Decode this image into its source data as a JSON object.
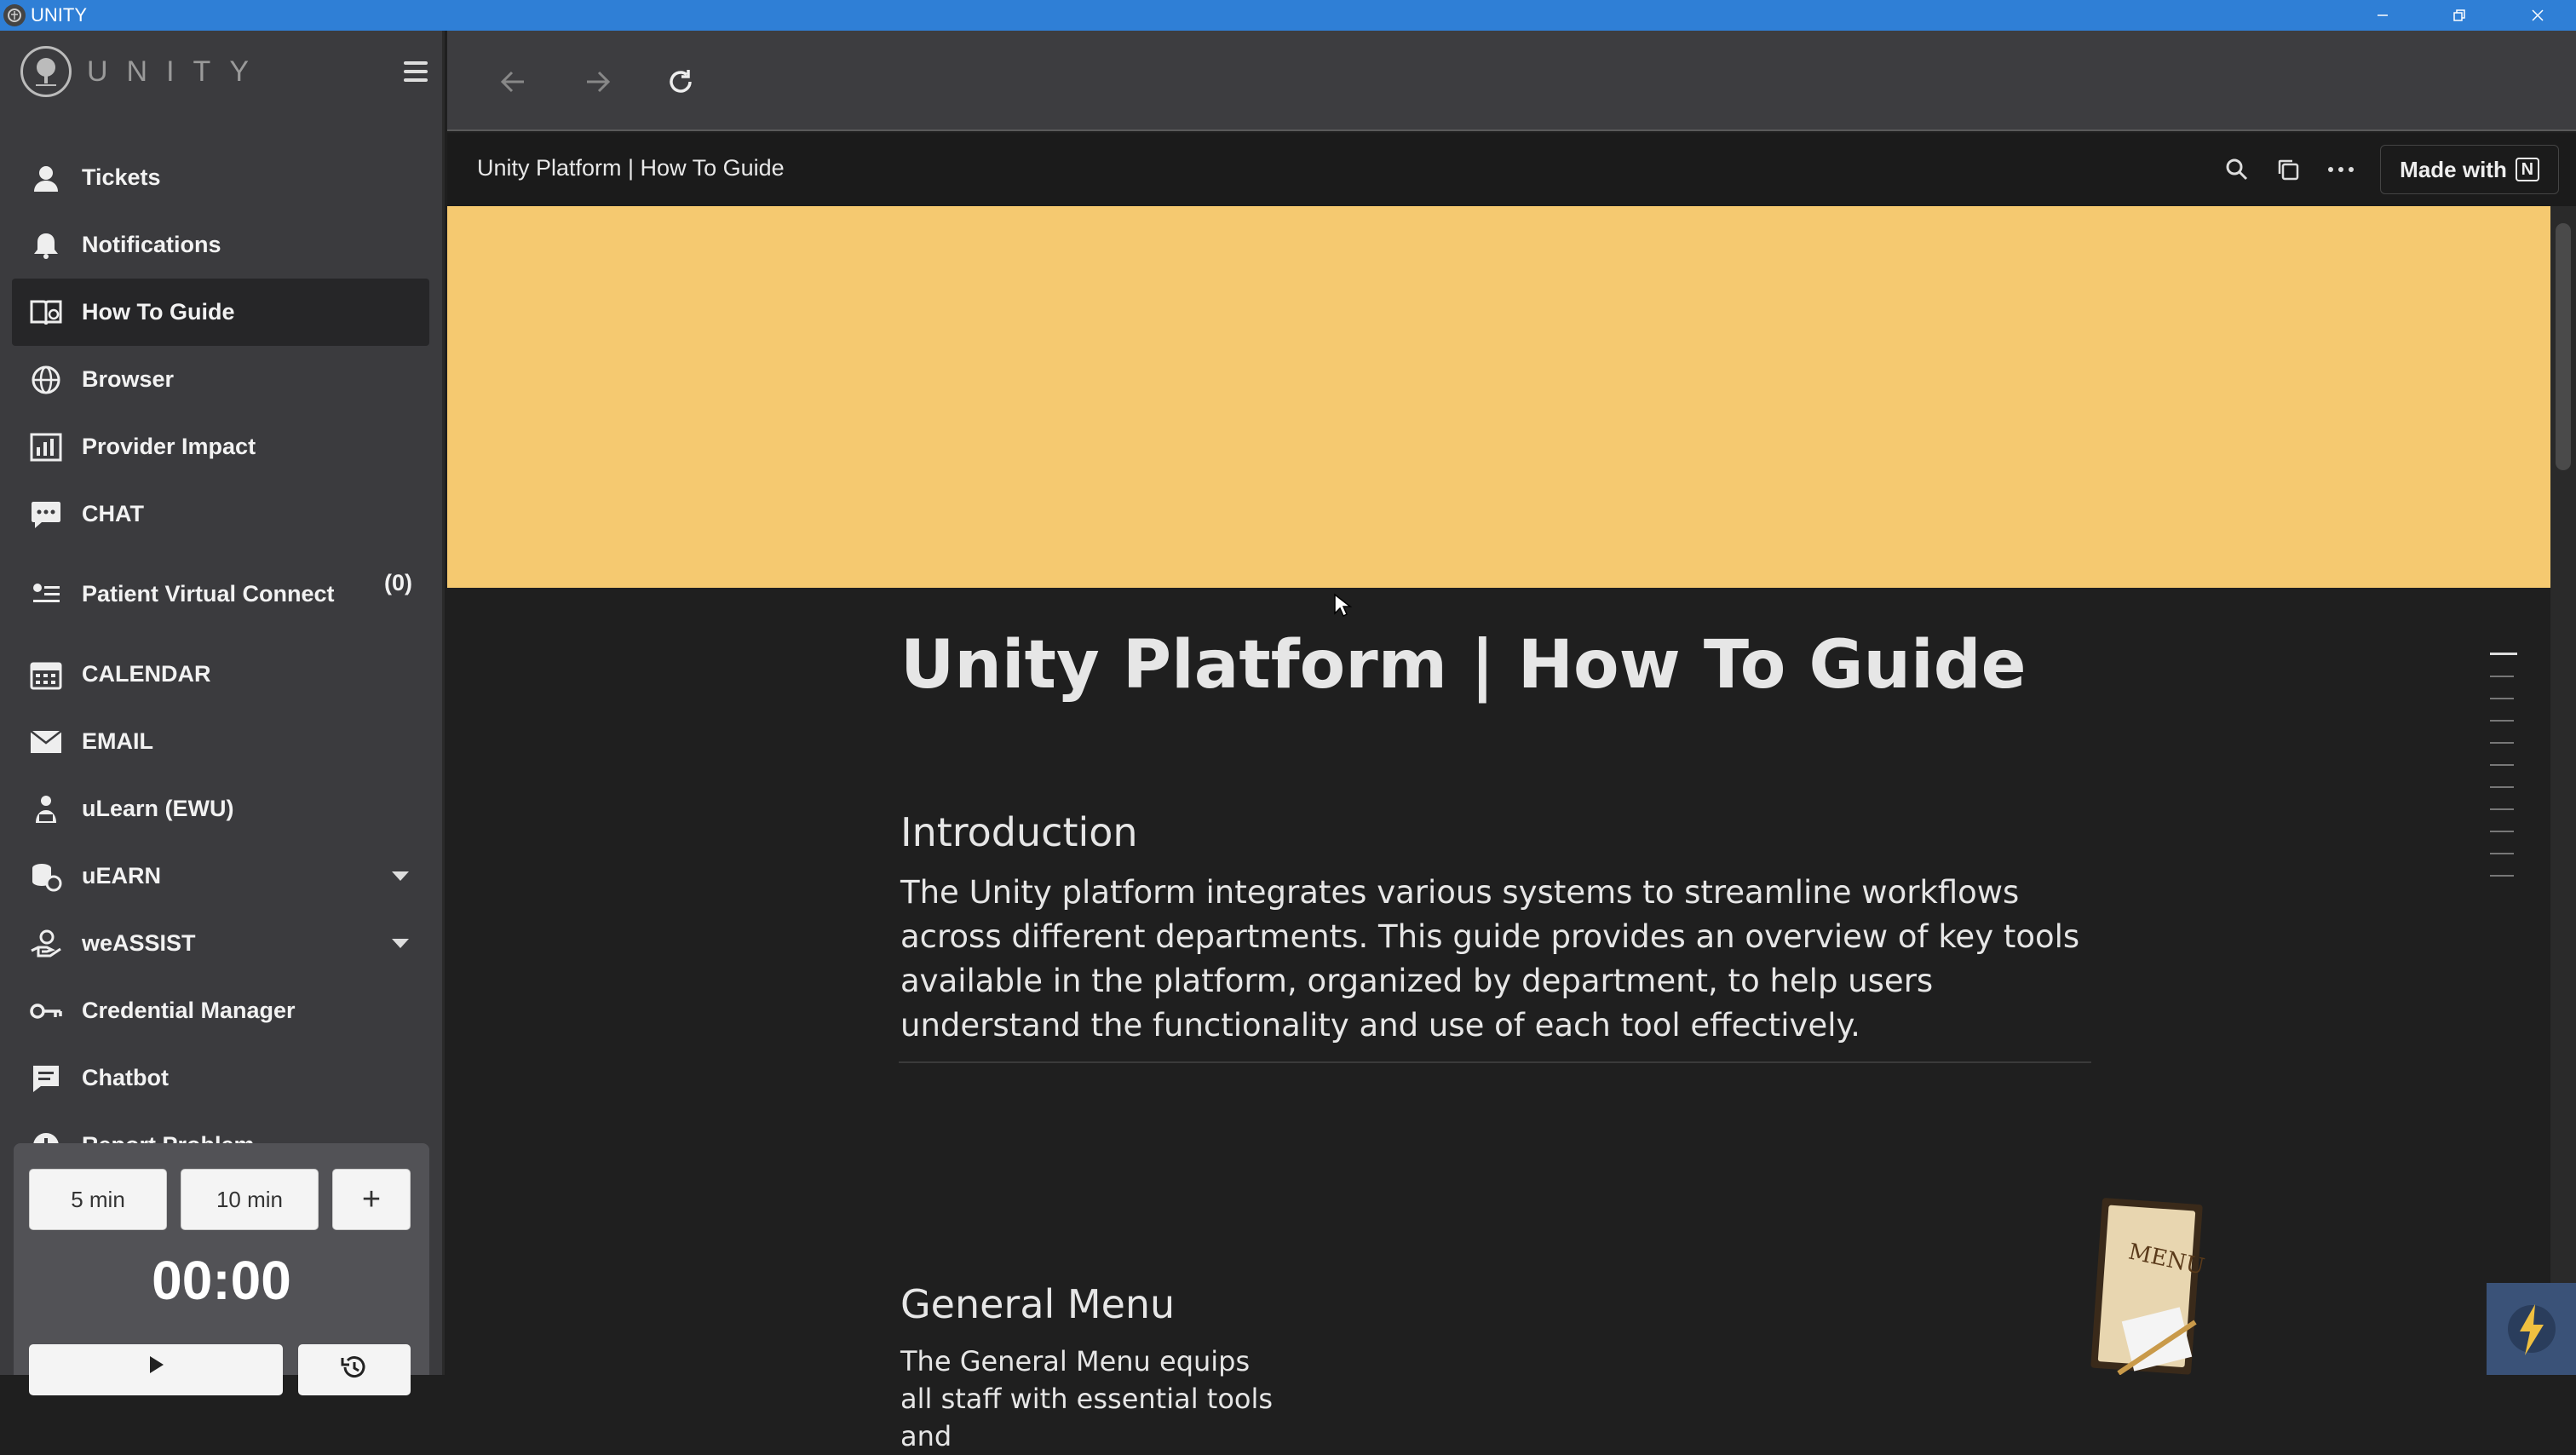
{
  "window": {
    "title": "UNITY"
  },
  "sidebar": {
    "logo_text": "UNITY",
    "items": [
      {
        "label": "Tickets",
        "icon": "ticket-person-icon"
      },
      {
        "label": "Notifications",
        "icon": "bell-icon"
      },
      {
        "label": "How To Guide",
        "icon": "book-icon",
        "active": true
      },
      {
        "label": "Browser",
        "icon": "globe-icon"
      },
      {
        "label": "Provider Impact",
        "icon": "chart-icon"
      },
      {
        "label": "CHAT",
        "icon": "chat-bubble-icon"
      },
      {
        "label": "Patient Virtual Connect",
        "icon": "people-list-icon",
        "count": "(0)"
      },
      {
        "label": "CALENDAR",
        "icon": "calendar-icon"
      },
      {
        "label": "EMAIL",
        "icon": "envelope-icon"
      },
      {
        "label": "uLearn (EWU)",
        "icon": "learner-icon"
      },
      {
        "label": "uEARN",
        "icon": "coins-icon",
        "expandable": true
      },
      {
        "label": "weASSIST",
        "icon": "helping-hand-icon",
        "expandable": true
      },
      {
        "label": "Credential Manager",
        "icon": "key-icon"
      },
      {
        "label": "Chatbot",
        "icon": "message-square-icon"
      },
      {
        "label": "Report Problem",
        "icon": "alert-circle-icon"
      }
    ]
  },
  "timer": {
    "preset_1": "5 min",
    "preset_2": "10 min",
    "add_label": "+",
    "display": "00:00"
  },
  "page": {
    "tab_title": "Unity Platform | How To Guide",
    "made_with": "Made with",
    "notion_glyph": "N",
    "cover_color": "#f5c970",
    "title": "Unity Platform | How To Guide",
    "intro_heading": "Introduction",
    "intro_text": "The Unity platform integrates various systems to streamline workflows across different departments. This guide provides an overview of key tools available in the platform, organized by department, to help users understand the functionality and use of each tool effectively.",
    "general_menu_heading": "General Menu",
    "general_menu_text": "The General Menu equips all staff with essential tools and",
    "menu_image_text": "MENU"
  },
  "colors": {
    "titlebar": "#2f7fd6",
    "sidebar": "#3b3b3e",
    "active_item": "#262628",
    "content_bg": "#1f1f1f"
  }
}
